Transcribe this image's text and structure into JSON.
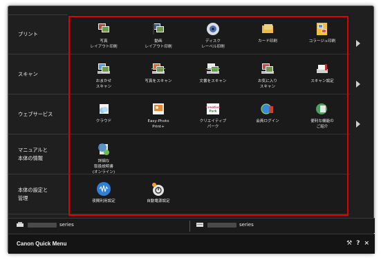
{
  "app": {
    "title": "Canon Quick Menu"
  },
  "categories": [
    {
      "lines": [
        "プリント"
      ]
    },
    {
      "lines": [
        "スキャン"
      ]
    },
    {
      "lines": [
        "ウェブサービス"
      ]
    },
    {
      "lines": [
        "マニュアルと",
        "本体の情報"
      ]
    },
    {
      "lines": [
        "本体の設定と",
        "管理"
      ]
    }
  ],
  "rows": [
    [
      {
        "icon": "photo-layout-print-icon",
        "lines": [
          "写真",
          "レイアウト印刷"
        ]
      },
      {
        "icon": "video-layout-print-icon",
        "lines": [
          "動画",
          "レイアウト印刷"
        ]
      },
      {
        "icon": "disc-label-print-icon",
        "lines": [
          "ディスク",
          "レーベル印刷"
        ]
      },
      {
        "icon": "card-print-icon",
        "lines": [
          "カード印刷"
        ]
      },
      {
        "icon": "collage-print-icon",
        "lines": [
          "コラージュ印刷"
        ]
      }
    ],
    [
      {
        "icon": "auto-scan-icon",
        "lines": [
          "おまかせ",
          "スキャン"
        ]
      },
      {
        "icon": "photo-scan-icon",
        "lines": [
          "写真をスキャン"
        ]
      },
      {
        "icon": "document-scan-icon",
        "lines": [
          "文書をスキャン"
        ]
      },
      {
        "icon": "favorite-scan-icon",
        "lines": [
          "お気に入り",
          "スキャン"
        ]
      },
      {
        "icon": "scan-settings-icon",
        "lines": [
          "スキャン設定"
        ]
      }
    ],
    [
      {
        "icon": "cloud-icon",
        "lines": [
          "クラウド"
        ]
      },
      {
        "icon": "easy-photoprint-icon",
        "lines": [
          "Easy-Photo",
          "Print+"
        ]
      },
      {
        "icon": "creative-park-icon",
        "lines": [
          "クリエイティブ",
          "パーク"
        ],
        "badge": [
          "Creative",
          "Park"
        ]
      },
      {
        "icon": "member-login-icon",
        "lines": [
          "会員ログイン"
        ]
      },
      {
        "icon": "useful-features-icon",
        "lines": [
          "便利な機能の",
          "ご紹介"
        ]
      }
    ],
    [
      {
        "icon": "online-manual-icon",
        "lines": [
          "詳細な",
          "取扱説明書",
          "(オンライン)"
        ]
      }
    ],
    [
      {
        "icon": "quiet-mode-icon",
        "lines": [
          "夜間利用設定"
        ]
      },
      {
        "icon": "auto-power-icon",
        "lines": [
          "自動電源設定"
        ]
      }
    ]
  ],
  "devices": [
    {
      "icon": "printer-icon",
      "label": "series"
    },
    {
      "icon": "scanner-icon",
      "label": "series"
    }
  ],
  "footer": {
    "settings": "⚒",
    "help": "?",
    "close": "×"
  },
  "colors": {
    "highlight": "#e00000",
    "background": "#1f1f1f"
  }
}
